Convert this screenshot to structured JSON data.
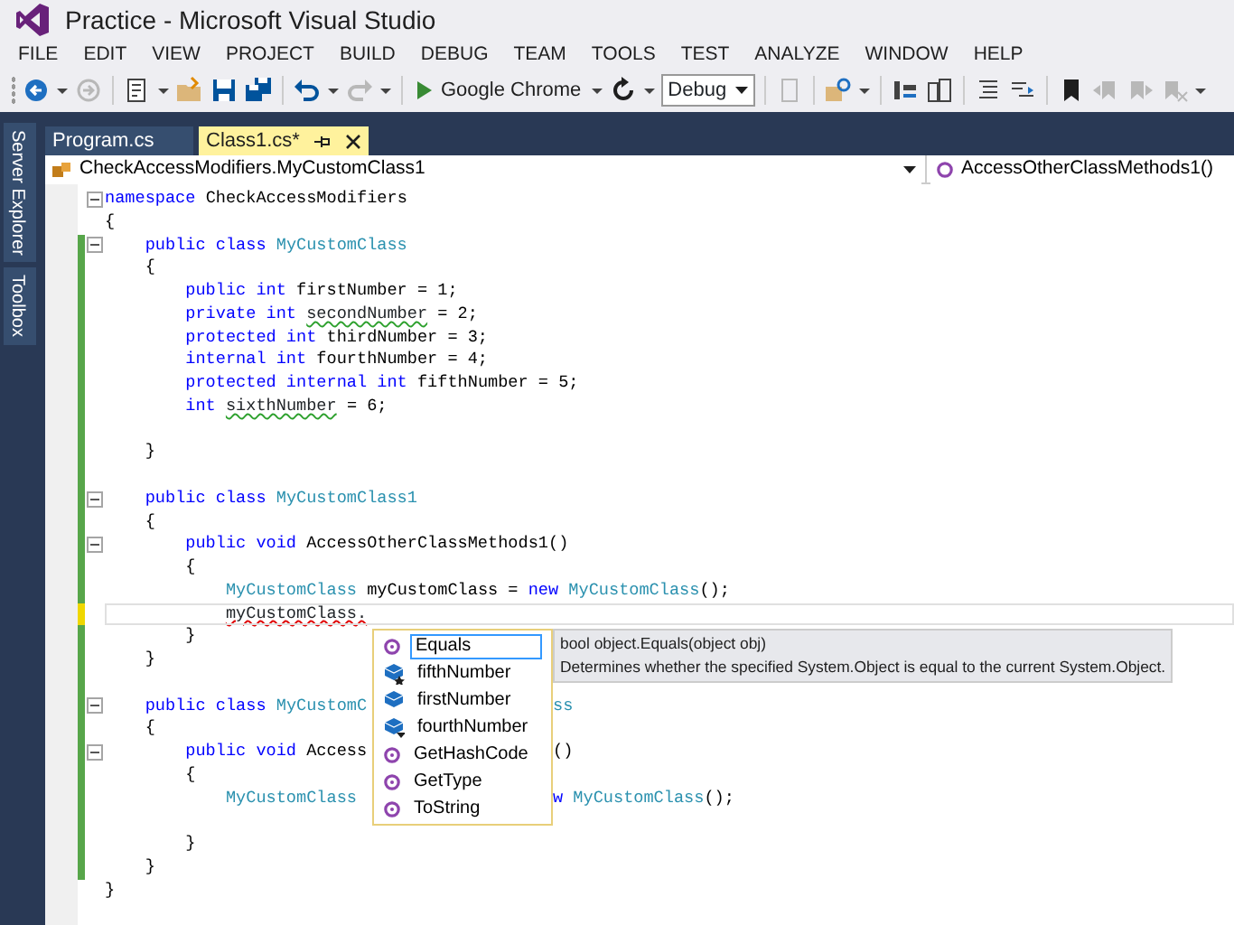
{
  "window": {
    "title": "Practice - Microsoft Visual Studio"
  },
  "menu": [
    "FILE",
    "EDIT",
    "VIEW",
    "PROJECT",
    "BUILD",
    "DEBUG",
    "TEAM",
    "TOOLS",
    "TEST",
    "ANALYZE",
    "WINDOW",
    "HELP"
  ],
  "toolbar": [
    {
      "kind": "icon",
      "disabled": false,
      "dropdown": true
    },
    {
      "kind": "icon",
      "disabled": true,
      "dropdown": false
    },
    {
      "kind": "sep"
    },
    {
      "kind": "icon",
      "disabled": false,
      "dropdown": true
    },
    {
      "kind": "icon",
      "disabled": false,
      "dropdown": false
    },
    {
      "kind": "icon",
      "disabled": false,
      "dropdown": false
    },
    {
      "kind": "icon",
      "disabled": false,
      "dropdown": false
    },
    {
      "kind": "sep"
    },
    {
      "kind": "icon",
      "disabled": false,
      "dropdown": true
    },
    {
      "kind": "icon",
      "disabled": true,
      "dropdown": true
    },
    {
      "kind": "sep"
    },
    {
      "kind": "start",
      "label": "Google Chrome",
      "dropdown": true
    },
    {
      "kind": "icon",
      "disabled": false,
      "dropdown": true
    },
    {
      "kind": "combo",
      "value": "Debug"
    },
    {
      "kind": "sep"
    },
    {
      "kind": "icon",
      "disabled": true,
      "dropdown": false
    },
    {
      "kind": "sep"
    },
    {
      "kind": "icon",
      "disabled": false,
      "dropdown": true
    },
    {
      "kind": "sep"
    },
    {
      "kind": "icon",
      "disabled": false,
      "dropdown": false
    },
    {
      "kind": "icon",
      "disabled": false,
      "dropdown": false
    },
    {
      "kind": "sep"
    },
    {
      "kind": "icon",
      "disabled": false,
      "dropdown": false
    },
    {
      "kind": "icon",
      "disabled": false,
      "dropdown": false
    },
    {
      "kind": "sep"
    },
    {
      "kind": "icon",
      "disabled": false,
      "dropdown": false
    },
    {
      "kind": "icon",
      "disabled": true,
      "dropdown": false
    },
    {
      "kind": "icon",
      "disabled": true,
      "dropdown": false
    },
    {
      "kind": "icon",
      "disabled": true,
      "dropdown": true
    }
  ],
  "side_tabs": [
    "Server Explorer",
    "Toolbox"
  ],
  "tabs": [
    {
      "label": "Program.cs",
      "selected": false
    },
    {
      "label": "Class1.cs*",
      "selected": true
    }
  ],
  "nav": {
    "type": "CheckAccessModifiers.MyCustomClass1",
    "member": "AccessOtherClassMethods1()"
  },
  "editor": {
    "lines": [
      {
        "tokens": [
          {
            "kind": "keyword",
            "text": "namespace"
          },
          {
            "kind": "plain",
            "text": " CheckAccessModifiers"
          }
        ],
        "fold": true,
        "modified": false,
        "current": false
      },
      {
        "tokens": [
          {
            "kind": "plain",
            "text": "{"
          }
        ],
        "fold": false,
        "modified": false,
        "current": false
      },
      {
        "tokens": [
          {
            "kind": "keyword",
            "text": "    public class "
          },
          {
            "kind": "type",
            "text": "MyCustomClass"
          }
        ],
        "fold": true,
        "modified": true,
        "saved": true,
        "current": false
      },
      {
        "tokens": [
          {
            "kind": "plain",
            "text": "    {"
          }
        ],
        "fold": false,
        "modified": true,
        "saved": true,
        "current": false
      },
      {
        "tokens": [
          {
            "kind": "keyword",
            "text": "        public int "
          },
          {
            "kind": "plain",
            "text": "firstNumber = 1;"
          }
        ],
        "fold": false,
        "modified": true,
        "saved": true,
        "current": false
      },
      {
        "tokens": [
          {
            "kind": "keyword",
            "text": "        private int "
          },
          {
            "kind": "warning",
            "text": "secondNumber"
          },
          {
            "kind": "plain",
            "text": " = 2;"
          }
        ],
        "fold": false,
        "modified": true,
        "saved": true,
        "current": false
      },
      {
        "tokens": [
          {
            "kind": "keyword",
            "text": "        protected int "
          },
          {
            "kind": "plain",
            "text": "thirdNumber = 3;"
          }
        ],
        "fold": false,
        "modified": true,
        "saved": true,
        "current": false
      },
      {
        "tokens": [
          {
            "kind": "keyword",
            "text": "        internal int "
          },
          {
            "kind": "plain",
            "text": "fourthNumber = 4;"
          }
        ],
        "fold": false,
        "modified": true,
        "saved": true,
        "current": false
      },
      {
        "tokens": [
          {
            "kind": "keyword",
            "text": "        protected internal int "
          },
          {
            "kind": "plain",
            "text": "fifthNumber = 5;"
          }
        ],
        "fold": false,
        "modified": true,
        "saved": true,
        "current": false
      },
      {
        "tokens": [
          {
            "kind": "keyword",
            "text": "        int "
          },
          {
            "kind": "warning",
            "text": "sixthNumber"
          },
          {
            "kind": "plain",
            "text": " = 6;"
          }
        ],
        "fold": false,
        "modified": true,
        "saved": true,
        "current": false
      },
      {
        "fold": false,
        "modified": true,
        "saved": true,
        "current": false
      },
      {
        "tokens": [
          {
            "kind": "plain",
            "text": "    }"
          }
        ],
        "fold": false,
        "modified": true,
        "saved": true,
        "current": false
      },
      {
        "fold": false,
        "modified": true,
        "saved": true,
        "current": false
      },
      {
        "tokens": [
          {
            "kind": "keyword",
            "text": "    public class "
          },
          {
            "kind": "type",
            "text": "MyCustomClass1"
          }
        ],
        "fold": true,
        "modified": true,
        "saved": true,
        "current": false
      },
      {
        "tokens": [
          {
            "kind": "plain",
            "text": "    {"
          }
        ],
        "fold": false,
        "modified": true,
        "saved": true,
        "current": false
      },
      {
        "tokens": [
          {
            "kind": "keyword",
            "text": "        public void "
          },
          {
            "kind": "plain",
            "text": "AccessOtherClassMethods1()"
          }
        ],
        "fold": true,
        "modified": true,
        "saved": true,
        "current": false
      },
      {
        "tokens": [
          {
            "kind": "plain",
            "text": "        {"
          }
        ],
        "fold": false,
        "modified": true,
        "saved": true,
        "current": false
      },
      {
        "tokens": [
          {
            "kind": "type",
            "text": "            MyCustomClass"
          },
          {
            "kind": "plain",
            "text": " myCustomClass = "
          },
          {
            "kind": "keyword",
            "text": "new "
          },
          {
            "kind": "type",
            "text": "MyCustomClass"
          },
          {
            "kind": "plain",
            "text": "();"
          }
        ],
        "fold": false,
        "modified": true,
        "saved": true,
        "current": false
      },
      {
        "tokens": [
          {
            "kind": "error",
            "text": "            myCustomClass."
          }
        ],
        "fold": false,
        "modified": true,
        "saved": false,
        "current": true
      },
      {
        "tokens": [
          {
            "kind": "plain",
            "text": "        }"
          }
        ],
        "fold": false,
        "modified": true,
        "saved": true,
        "current": false
      },
      {
        "tokens": [
          {
            "kind": "plain",
            "text": "    }"
          }
        ],
        "fold": false,
        "modified": true,
        "saved": true,
        "current": false
      },
      {
        "fold": false,
        "modified": true,
        "saved": true,
        "current": false
      },
      {
        "tokens": [
          {
            "kind": "keyword",
            "text": "    public class "
          },
          {
            "kind": "type",
            "text": "MyCustomC"
          }
        ],
        "after_popup": [
          {
            "kind": "type",
            "text": "ss"
          }
        ],
        "fold": true,
        "modified": true,
        "saved": true,
        "current": false
      },
      {
        "tokens": [
          {
            "kind": "plain",
            "text": "    {"
          }
        ],
        "fold": false,
        "modified": true,
        "saved": true,
        "current": false
      },
      {
        "tokens": [
          {
            "kind": "keyword",
            "text": "        public void "
          },
          {
            "kind": "plain",
            "text": "Access"
          }
        ],
        "after_popup": [
          {
            "kind": "plain",
            "text": "()"
          }
        ],
        "fold": true,
        "modified": true,
        "saved": true,
        "current": false
      },
      {
        "tokens": [
          {
            "kind": "plain",
            "text": "        {"
          }
        ],
        "fold": false,
        "modified": true,
        "saved": true,
        "current": false
      },
      {
        "tokens": [
          {
            "kind": "type",
            "text": "            MyCustomClass"
          }
        ],
        "after_popup": [
          {
            "kind": "keyword",
            "text": "w "
          },
          {
            "kind": "type",
            "text": "MyCustomClass"
          },
          {
            "kind": "plain",
            "text": "();"
          }
        ],
        "fold": false,
        "modified": true,
        "saved": true,
        "current": false
      },
      {
        "fold": false,
        "modified": true,
        "saved": true,
        "current": false
      },
      {
        "tokens": [
          {
            "kind": "plain",
            "text": "        }"
          }
        ],
        "fold": false,
        "modified": true,
        "saved": true,
        "current": false
      },
      {
        "tokens": [
          {
            "kind": "plain",
            "text": "    }"
          }
        ],
        "fold": false,
        "modified": true,
        "saved": true,
        "current": false
      },
      {
        "tokens": [
          {
            "kind": "plain",
            "text": "}"
          }
        ],
        "fold": false,
        "modified": false,
        "current": false
      }
    ]
  },
  "completion": {
    "items": [
      {
        "label": "Equals",
        "kind": "method",
        "selected": true
      },
      {
        "label": "fifthNumber",
        "kind": "field-protected-internal",
        "selected": false
      },
      {
        "label": "firstNumber",
        "kind": "field",
        "selected": false
      },
      {
        "label": "fourthNumber",
        "kind": "field-internal",
        "selected": false
      },
      {
        "label": "GetHashCode",
        "kind": "method",
        "selected": false
      },
      {
        "label": "GetType",
        "kind": "method",
        "selected": false
      },
      {
        "label": "ToString",
        "kind": "method",
        "selected": false
      }
    ],
    "tooltip": {
      "signature": "bool object.Equals(object obj)",
      "description": "Determines whether the specified System.Object is equal to the current System.Object."
    }
  }
}
